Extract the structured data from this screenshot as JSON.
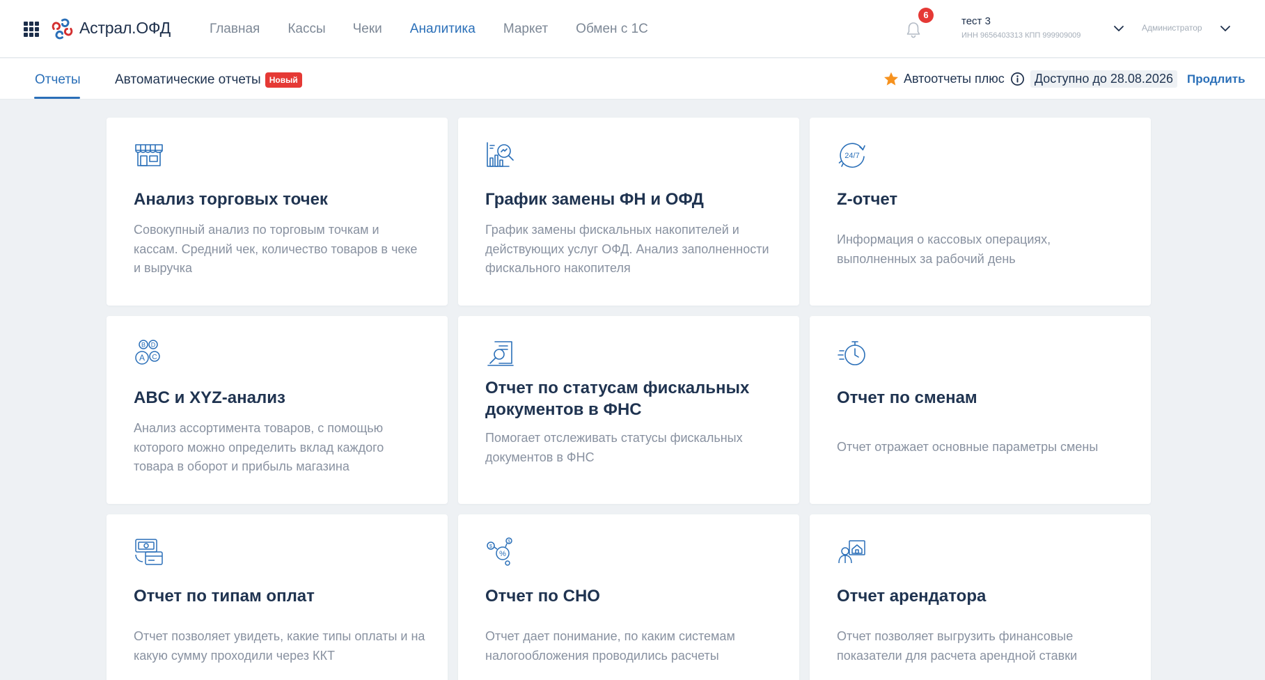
{
  "header": {
    "logo_text": "Астрал.ОФД",
    "nav": [
      {
        "label": "Главная",
        "active": false
      },
      {
        "label": "Кассы",
        "active": false
      },
      {
        "label": "Чеки",
        "active": false
      },
      {
        "label": "Аналитика",
        "active": true
      },
      {
        "label": "Маркет",
        "active": false
      },
      {
        "label": "Обмен с 1С",
        "active": false
      }
    ],
    "notifications_count": "6",
    "org_name": "тест 3",
    "org_details": "ИНН 9656403313  КПП 999909009",
    "role": "Администратор"
  },
  "subbar": {
    "tabs": [
      {
        "label": "Отчеты",
        "active": true
      },
      {
        "label": "Автоматические отчеты",
        "active": false
      }
    ],
    "new_badge": "Новый",
    "autoreports_plus": "Автоотчеты плюс",
    "available_until": "Доступно до 28.08.2026",
    "renew": "Продлить"
  },
  "colors": {
    "accent": "#2a6fb8",
    "badge_red": "#e53935",
    "star": "#f6921e",
    "background": "#eef1f4",
    "title": "#1f3350",
    "muted": "#8891a0"
  },
  "cards": [
    {
      "icon": "store-icon",
      "title": "Анализ торговых точек",
      "description": "Совокупный анализ по торговым точкам и кассам. Средний чек, количество товаров в чеке и выручка"
    },
    {
      "icon": "chart-search-icon",
      "title": "График замены ФН и ОФД",
      "description": "График замены фискальных накопителей и действующих услуг ОФД. Анализ заполненности фискального накопителя"
    },
    {
      "icon": "clock-24-7-icon",
      "title": "Z-отчет",
      "description": "Информация о кассовых операциях, выполненных за рабочий день"
    },
    {
      "icon": "abc-xyz-icon",
      "title": "ABC и XYZ-анализ",
      "description": "Анализ ассортимента товаров, с помощью которого можно определить вклад каждого товара в оборот и прибыль магазина"
    },
    {
      "icon": "document-search-icon",
      "title": "Отчет по статусам фискальных документов в ФНС",
      "description": "Помогает отслеживать статусы фискальных документов в ФНС"
    },
    {
      "icon": "stopwatch-icon",
      "title": "Отчет по сменам",
      "description": "Отчет отражает основные параметры смены"
    },
    {
      "icon": "payment-types-icon",
      "title": "Отчет по типам оплат",
      "description": "Отчет позволяет увидеть, какие типы оплаты и на какую сумму проходили через ККТ"
    },
    {
      "icon": "tax-system-icon",
      "title": "Отчет по СНО",
      "description": "Отчет дает понимание, по каким системам налогообложения проводились расчеты"
    },
    {
      "icon": "tenant-icon",
      "title": "Отчет арендатора",
      "description": "Отчет позволяет выгрузить финансовые показатели для расчета арендной ставки"
    }
  ]
}
